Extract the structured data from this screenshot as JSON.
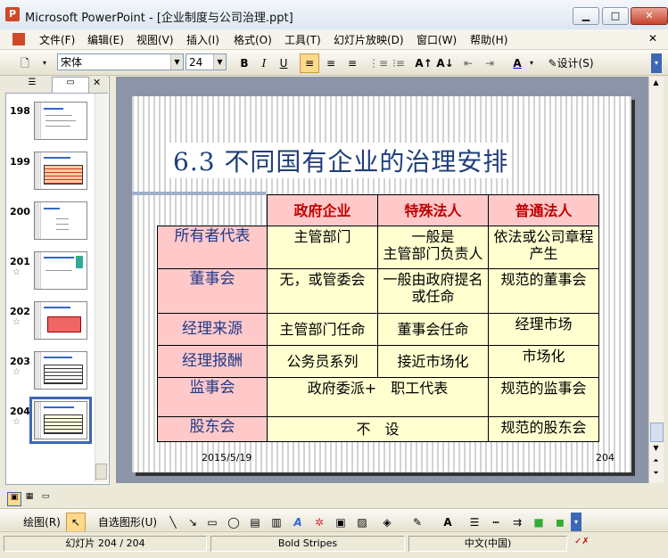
{
  "window": {
    "title": "Microsoft PowerPoint - [企业制度与公司治理.ppt]",
    "min": "▁",
    "max": "□",
    "close": "✕"
  },
  "menu": [
    "文件(F)",
    "编辑(E)",
    "视图(V)",
    "插入(I)",
    "格式(O)",
    "工具(T)",
    "幻灯片放映(D)",
    "窗口(W)",
    "帮助(H)"
  ],
  "toolbar": {
    "font_name": "宋体",
    "font_size": "24",
    "bold": "B",
    "italic": "I",
    "underline": "U",
    "design_label": "设计(S)"
  },
  "thumbnails": [
    {
      "num": "198",
      "star": ""
    },
    {
      "num": "199",
      "star": ""
    },
    {
      "num": "200",
      "star": ""
    },
    {
      "num": "201",
      "star": "☆"
    },
    {
      "num": "202",
      "star": "☆"
    },
    {
      "num": "203",
      "star": "☆"
    },
    {
      "num": "204",
      "star": "☆"
    }
  ],
  "slide": {
    "title": "6.3 不同国有企业的治理安排",
    "date": "2015/5/19",
    "page": "204",
    "table": {
      "headers": [
        "政府企业",
        "特殊法人",
        "普通法人"
      ],
      "rows": [
        {
          "label": "所有者代表",
          "cells": [
            "主管部门",
            "一般是\n主管部门负责人",
            "依法或公司章程产生"
          ]
        },
        {
          "label": "董事会",
          "cells": [
            "无，或管委会",
            "一般由政府提名或任命",
            "规范的董事会"
          ]
        },
        {
          "label": "经理来源",
          "cells": [
            "主管部门任命",
            "董事会任命",
            "经理市场"
          ]
        },
        {
          "label": "经理报酬",
          "cells": [
            "公务员系列",
            "接近市场化",
            "市场化"
          ]
        },
        {
          "label": "监事会",
          "merged": "政府委派+　职工代表",
          "last": "规范的监事会"
        },
        {
          "label": "股东会",
          "merged": "不　设",
          "last": "规范的股东会"
        }
      ]
    }
  },
  "drawbar": {
    "draw": "绘图(R)",
    "autoshape": "自选图形(U)"
  },
  "status": {
    "slide": "幻灯片 204 / 204",
    "design": "Bold Stripes",
    "lang": "中文(中国)"
  },
  "colors": {
    "header_bg": "#ffc9c9",
    "cell_bg": "#ffffd0",
    "title": "#1f3f7a",
    "header_text": "#c00000"
  }
}
